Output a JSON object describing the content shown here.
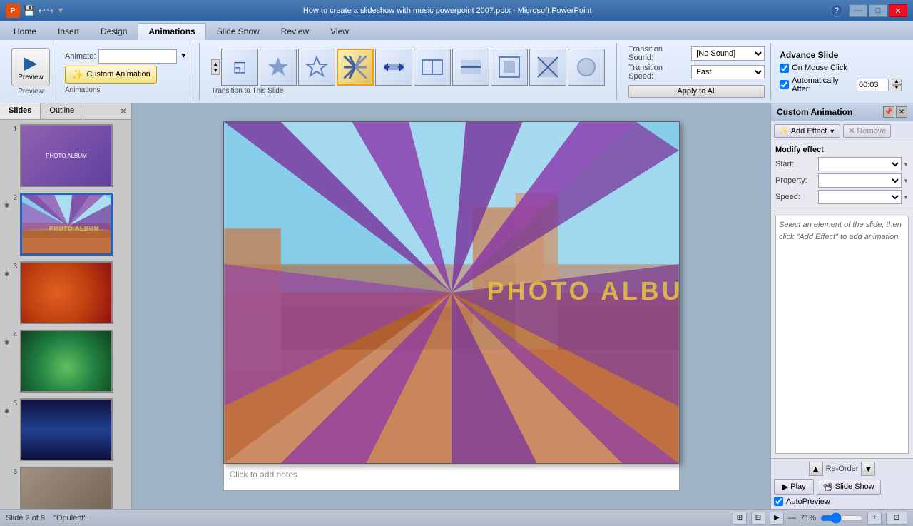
{
  "titleBar": {
    "title": "How to create a slideshow with music powerpoint 2007.pptx - Microsoft PowerPoint",
    "quickAccess": [
      "💾",
      "↩",
      "↪"
    ],
    "winButtons": [
      "—",
      "□",
      "✕"
    ]
  },
  "ribbon": {
    "tabs": [
      "Home",
      "Insert",
      "Design",
      "Animations",
      "Slide Show",
      "Review",
      "View"
    ],
    "activeTab": "Animations",
    "helpIcon": "?"
  },
  "previewGroup": {
    "label": "Preview",
    "buttonLabel": "Preview"
  },
  "animationsGroup": {
    "label": "Animations",
    "animateLabel": "Animate:",
    "customAnimBtn": "Custom Animation"
  },
  "transitionGroup": {
    "label": "Transition to This Slide",
    "icons": [
      "◱",
      "✦",
      "✧",
      "★",
      "↔",
      "⇔",
      "⇄",
      "⊞",
      "⊠",
      "⊡"
    ],
    "activeIndex": 3
  },
  "transitionSettings": {
    "soundLabel": "Transition Sound:",
    "soundValue": "[No Sound]",
    "speedLabel": "Transition Speed:",
    "speedValue": "Fast",
    "applyLabel": "Apply to All"
  },
  "advanceSlide": {
    "title": "Advance Slide",
    "onMouseClick": "On Mouse Click",
    "autoLabel": "Automatically After:",
    "autoTime": "00:03"
  },
  "slidesPanel": {
    "tabs": [
      "Slides",
      "Outline"
    ],
    "slides": [
      {
        "number": "1",
        "hasIcon": false
      },
      {
        "number": "2",
        "hasIcon": true
      },
      {
        "number": "3",
        "hasIcon": true
      },
      {
        "number": "4",
        "hasIcon": true
      },
      {
        "number": "5",
        "hasIcon": true
      },
      {
        "number": "6",
        "hasIcon": false
      }
    ],
    "activeSlide": 1
  },
  "slideCanvas": {
    "title": "PHOTO ALBUM"
  },
  "notes": {
    "placeholder": "Click to add notes"
  },
  "customAnimation": {
    "title": "Custom Animation",
    "addEffectBtn": "Add Effect",
    "removeBtn": "Remove",
    "modifyEffect": "Modify effect",
    "startLabel": "Start:",
    "propertyLabel": "Property:",
    "speedLabel": "Speed:",
    "hintText": "Select an element of the slide, then click \"Add Effect\" to add animation.",
    "reorderLabel": "Re-Order",
    "playBtn": "Play",
    "slideshowBtn": "Slide Show",
    "autoPreview": "AutoPreview"
  },
  "statusBar": {
    "slideInfo": "Slide 2 of 9",
    "theme": "\"Opulent\"",
    "zoom": "71%"
  }
}
